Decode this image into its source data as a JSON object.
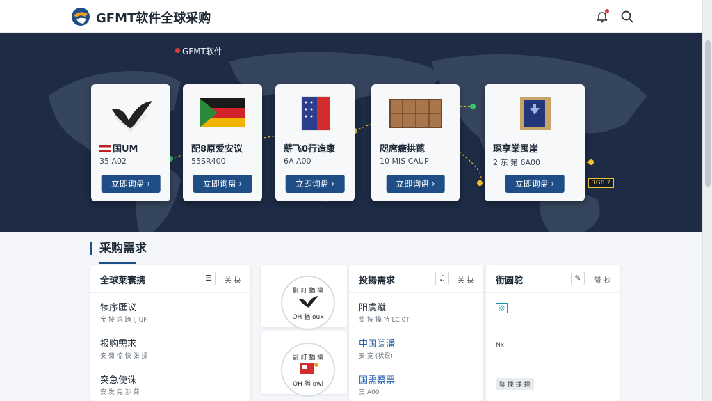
{
  "header": {
    "site_title": "GFMT软件全球采购",
    "logo_icon": "globe-logo-icon",
    "bell_icon": "notification-bell-icon",
    "search_icon": "search-icon"
  },
  "hero": {
    "tag": "GFMT软件",
    "route_label": "3G8 7",
    "cards": [
      {
        "name": "国UM",
        "price": "35 A02",
        "button": "立即询盘 ›",
        "image": "checkmark-emblem-icon"
      },
      {
        "name": "配8原爱安议",
        "price": "55SR400",
        "button": "立即询盘 ›",
        "image": "germany-flag-icon"
      },
      {
        "name": "薪飞0行造康",
        "price": "6A A00",
        "button": "立即询盘 ›",
        "image": "us-flag-icon"
      },
      {
        "name": "咫席癥拱蓖",
        "price": "10 MIS CAUP",
        "button": "立即询盘 ›",
        "image": "wooden-crates-icon"
      },
      {
        "name": "琛享棠囤崖",
        "price": "2 东 第 6A00",
        "button": "立即询盘 ›",
        "image": "cargo-box-icon"
      }
    ]
  },
  "demand": {
    "section_title": "采购需求",
    "panels": [
      {
        "title": "全球莱寰携",
        "more": "关 抉",
        "icon": "list-icon",
        "rows": [
          {
            "title": "犊序匯议",
            "sub": "宝 按 求 跨 IJ UF"
          },
          {
            "title": "报购需求",
            "sub": "安 菊 惊 快 张 揉"
          },
          {
            "title": "突急使诛",
            "sub": "安 发 完 涉 菊"
          }
        ]
      },
      {
        "title": "投揚需求",
        "more": "关 抉",
        "icon": "bell-icon",
        "rows": [
          {
            "title": "阳虞蹴",
            "sub": "奖 按 操 持 LC 0T"
          },
          {
            "title": "中国阔潘",
            "sub": "安 宽 (状跟)"
          },
          {
            "title": "国需蔡票",
            "sub": "三 A00"
          }
        ]
      },
      {
        "title": "衔圆鸵",
        "more": "赞 抄",
        "icon": "edit-icon",
        "rows": [
          {
            "title": "",
            "sub": ""
          },
          {
            "title": "",
            "sub": ""
          },
          {
            "title": "",
            "sub": ""
          }
        ],
        "tags": [
          "诊",
          "Nk",
          "聊 揉 揉 揉"
        ]
      }
    ],
    "badges": [
      {
        "top": "副 訂 猶 撬",
        "bottom": "OH 猶 oux",
        "image": "checkmark-emblem-icon"
      },
      {
        "top": "副 訂 猶 撬",
        "bottom": "OH 猶 owl",
        "image": "red-package-icon"
      }
    ]
  },
  "colors": {
    "brand_blue": "#1f4e86",
    "hero_bg": "#1d2b45",
    "alert_red": "#e23b3b",
    "route_yellow": "#f4c430"
  }
}
